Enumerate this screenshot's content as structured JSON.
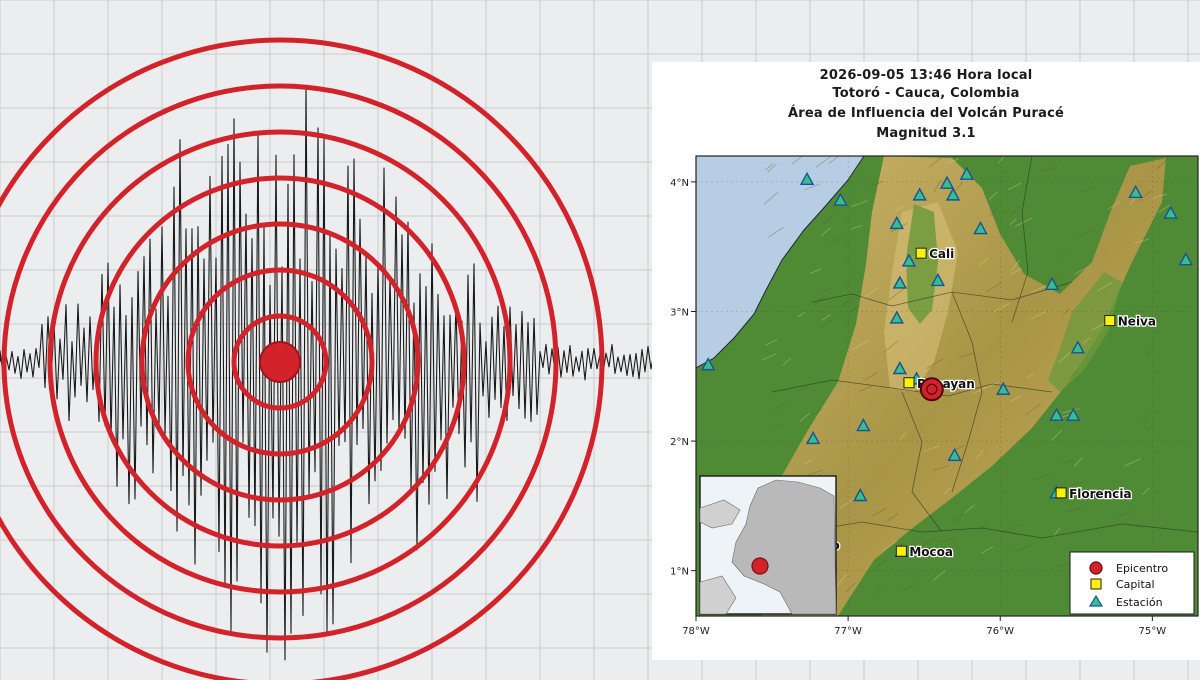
{
  "colors": {
    "ring": "#d2232a",
    "epicenter": "#d2232a",
    "trace": "#1a1a1a",
    "grid": "#c9cbce",
    "capital_fill": "#fff200",
    "station_fill": "#35c08a",
    "station_stroke": "#1c4f9c",
    "sea": "#b7cde3",
    "lowland": "#4f8a34",
    "highland": "#b8a24e"
  },
  "seismograph": {
    "icon": "epicenter-rings-icon",
    "ring_count": 7
  },
  "map": {
    "title_lines": [
      "2026-09-05 13:46 Hora local",
      "Totoró - Cauca, Colombia",
      "Área de Influencia del Volcán Puracé",
      "Magnitud 3.1"
    ],
    "lon_ticks": [
      "78°W",
      "77°W",
      "76°W",
      "75°W"
    ],
    "lat_ticks": [
      "4°N",
      "3°N",
      "2°N",
      "1°N"
    ],
    "bounds": {
      "lon_min": -78.0,
      "lon_max": -74.7,
      "lat_min": 0.65,
      "lat_max": 4.2
    },
    "epicenter": {
      "lon": -76.45,
      "lat": 2.4
    },
    "cities": [
      {
        "name": "Cali",
        "lon": -76.52,
        "lat": 3.45
      },
      {
        "name": "Popayan",
        "lon": -76.6,
        "lat": 2.45
      },
      {
        "name": "Neiva",
        "lon": -75.28,
        "lat": 2.93
      },
      {
        "name": "Florencia",
        "lon": -75.6,
        "lat": 1.6
      },
      {
        "name": "Mocoa",
        "lon": -76.65,
        "lat": 1.15
      },
      {
        "name": "asto",
        "lon": -77.3,
        "lat": 1.2
      }
    ],
    "stations": [
      {
        "lon": -77.27,
        "lat": 4.02
      },
      {
        "lon": -77.05,
        "lat": 3.86
      },
      {
        "lon": -76.68,
        "lat": 3.68
      },
      {
        "lon": -76.53,
        "lat": 3.9
      },
      {
        "lon": -76.35,
        "lat": 3.99
      },
      {
        "lon": -76.31,
        "lat": 3.9
      },
      {
        "lon": -76.22,
        "lat": 4.06
      },
      {
        "lon": -76.13,
        "lat": 3.64
      },
      {
        "lon": -76.6,
        "lat": 3.39
      },
      {
        "lon": -76.66,
        "lat": 3.22
      },
      {
        "lon": -76.41,
        "lat": 3.24
      },
      {
        "lon": -76.68,
        "lat": 2.95
      },
      {
        "lon": -75.66,
        "lat": 3.21
      },
      {
        "lon": -75.11,
        "lat": 3.92
      },
      {
        "lon": -74.88,
        "lat": 3.76
      },
      {
        "lon": -74.78,
        "lat": 3.4
      },
      {
        "lon": -75.49,
        "lat": 2.72
      },
      {
        "lon": -77.92,
        "lat": 2.59
      },
      {
        "lon": -76.66,
        "lat": 2.56
      },
      {
        "lon": -76.55,
        "lat": 2.48
      },
      {
        "lon": -75.98,
        "lat": 2.4
      },
      {
        "lon": -75.63,
        "lat": 2.2
      },
      {
        "lon": -75.52,
        "lat": 2.2
      },
      {
        "lon": -77.23,
        "lat": 2.02
      },
      {
        "lon": -76.9,
        "lat": 2.12
      },
      {
        "lon": -76.3,
        "lat": 1.89
      },
      {
        "lon": -76.92,
        "lat": 1.58
      },
      {
        "lon": -75.63,
        "lat": 1.6
      },
      {
        "lon": -76.65,
        "lat": 1.15
      }
    ],
    "legend": [
      {
        "label": "Epicentro",
        "icon": "epicenter-marker-icon"
      },
      {
        "label": "Capital",
        "icon": "capital-square-icon"
      },
      {
        "label": "Estación",
        "icon": "station-triangle-icon"
      }
    ],
    "inset": {
      "icon": "colombia-inset-map-icon"
    }
  }
}
